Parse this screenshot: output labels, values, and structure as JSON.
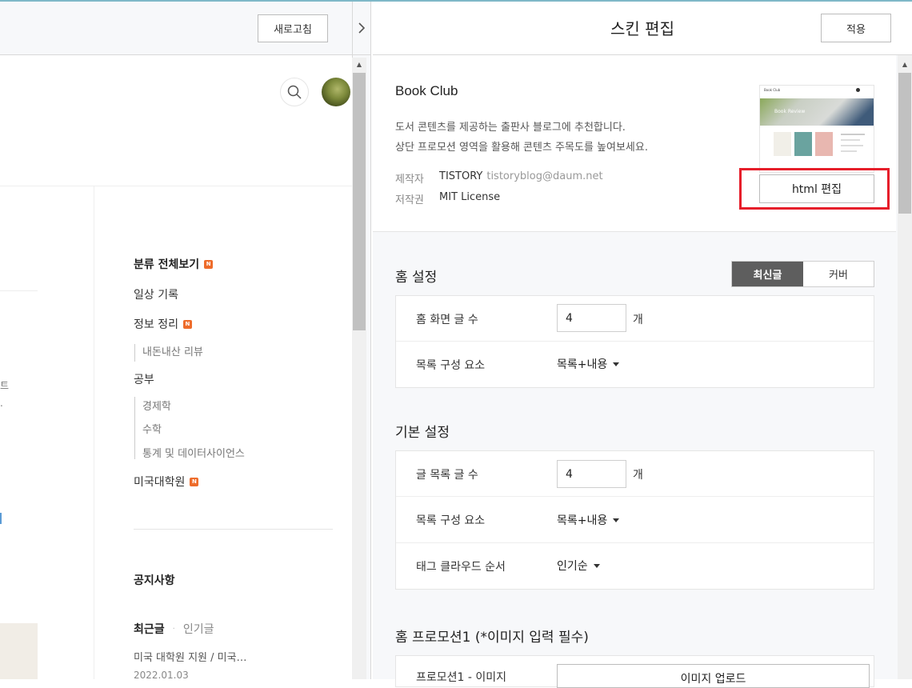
{
  "toolbar": {
    "refresh_label": "새로고침",
    "collapse_icon": "chevron-right-icon"
  },
  "preview": {
    "categories": [
      {
        "label": "분류 전체보기",
        "new": true
      },
      {
        "label": "일상 기록",
        "new": false
      },
      {
        "label": "정보 정리",
        "new": true,
        "sub": [
          "내돈내산 리뷰"
        ]
      },
      {
        "label": "공부",
        "new": false,
        "sub": [
          "경제학",
          "수학",
          "통계 및 데이터사이언스"
        ]
      },
      {
        "label": "미국대학원",
        "new": true
      }
    ],
    "new_badge": "N",
    "left_fragments": [
      "트",
      "."
    ],
    "notice_title": "공지사항",
    "recent_tab": "최근글",
    "popular_tab": "인기글",
    "tab_divider": "·",
    "recent_post": {
      "title": "미국 대학원 지원 / 미국…",
      "date": "2022.01.03"
    }
  },
  "panel": {
    "title": "스킨 편집",
    "apply_label": "적용",
    "skin": {
      "name": "Book Club",
      "description_1": "도서 콘텐츠를 제공하는 출판사 블로그에 추천합니다.",
      "description_2": "상단 프로모션 영역을 활용해 콘텐츠 주목도를 높여보세요.",
      "maker_label": "제작자",
      "maker_name": "TISTORY",
      "maker_email": "tistoryblog@daum.net",
      "license_label": "저작권",
      "license_value": "MIT License",
      "html_edit_label": "html 편집",
      "thumb_title": "Book Club",
      "thumb_hero_text": "Book Review"
    },
    "home_settings": {
      "title": "홈 설정",
      "seg_latest": "최신글",
      "seg_cover": "커버",
      "post_count_label": "홈 화면 글 수",
      "post_count_value": "4",
      "unit": "개",
      "list_elements_label": "목록 구성 요소",
      "list_elements_value": "목록+내용"
    },
    "basic_settings": {
      "title": "기본 설정",
      "post_count_label": "글 목록 글 수",
      "post_count_value": "4",
      "unit": "개",
      "list_elements_label": "목록 구성 요소",
      "list_elements_value": "목록+내용",
      "tag_cloud_label": "태그 클라우드 순서",
      "tag_cloud_value": "인기순"
    },
    "promotion": {
      "title": "홈 프로모션1 (*이미지 입력 필수)",
      "image_label": "프로모션1 - 이미지",
      "upload_label": "이미지 업로드"
    }
  },
  "colors": {
    "highlight": "#e61e2a",
    "new_badge": "#ee6c2b",
    "segment_active": "#5e5e5e"
  }
}
